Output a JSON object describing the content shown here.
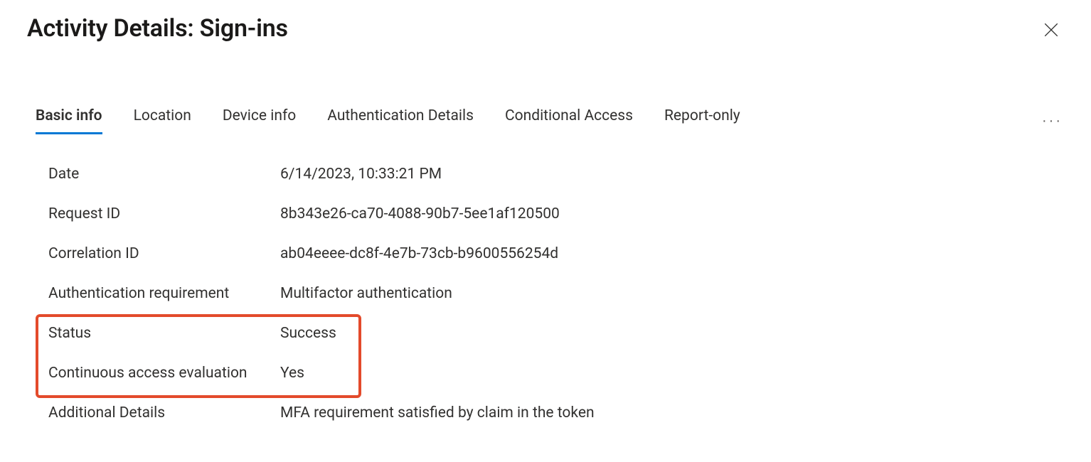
{
  "header": {
    "title": "Activity Details: Sign-ins"
  },
  "tabs": [
    {
      "label": "Basic info",
      "active": true
    },
    {
      "label": "Location",
      "active": false
    },
    {
      "label": "Device info",
      "active": false
    },
    {
      "label": "Authentication Details",
      "active": false
    },
    {
      "label": "Conditional Access",
      "active": false
    },
    {
      "label": "Report-only",
      "active": false
    }
  ],
  "details": {
    "date": {
      "label": "Date",
      "value": "6/14/2023, 10:33:21 PM"
    },
    "request_id": {
      "label": "Request ID",
      "value": "8b343e26-ca70-4088-90b7-5ee1af120500"
    },
    "correlation_id": {
      "label": "Correlation ID",
      "value": "ab04eeee-dc8f-4e7b-73cb-b9600556254d"
    },
    "auth_requirement": {
      "label": "Authentication requirement",
      "value": "Multifactor authentication"
    },
    "status": {
      "label": "Status",
      "value": "Success"
    },
    "cae": {
      "label": "Continuous access evaluation",
      "value": "Yes"
    },
    "additional": {
      "label": "Additional Details",
      "value": "MFA requirement satisfied by claim in the token"
    }
  }
}
